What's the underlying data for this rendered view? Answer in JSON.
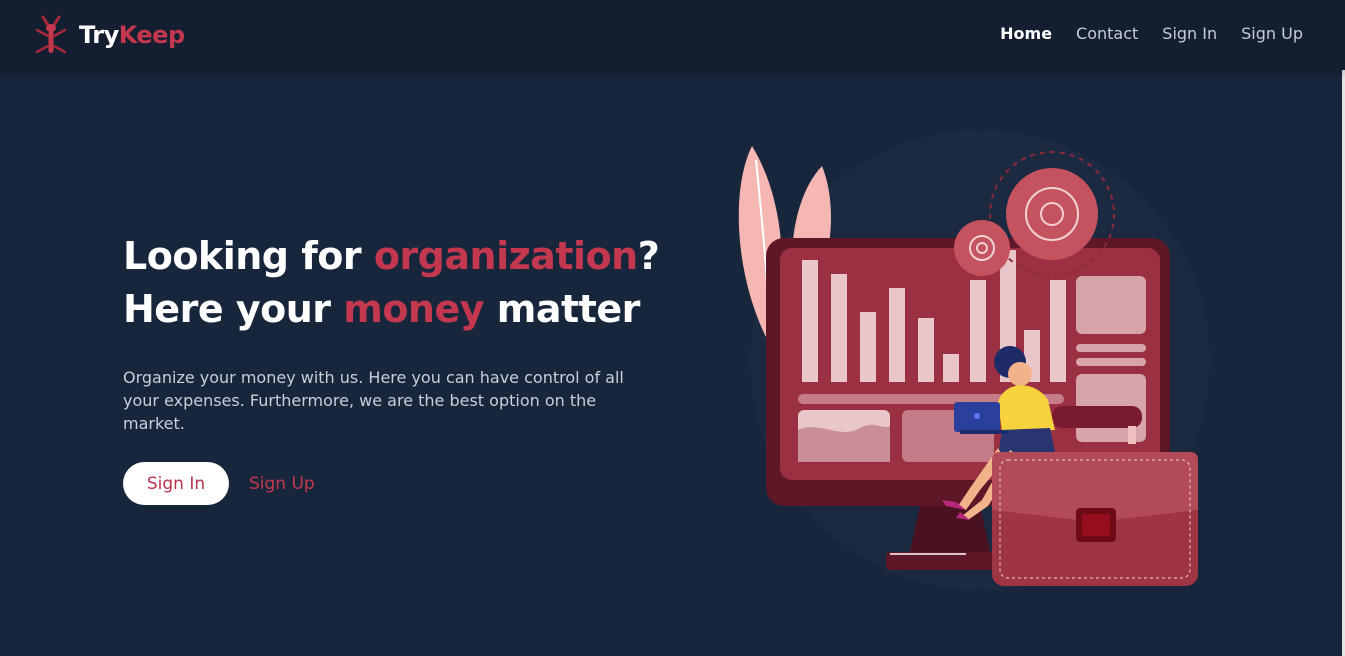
{
  "brand": {
    "name_part1": "Try",
    "name_part2": "Keep"
  },
  "nav": {
    "items": [
      {
        "label": "Home",
        "active": true
      },
      {
        "label": "Contact",
        "active": false
      },
      {
        "label": "Sign In",
        "active": false
      },
      {
        "label": "Sign Up",
        "active": false
      }
    ]
  },
  "hero": {
    "line1_pre": "Looking for ",
    "line1_accent": "organization",
    "line1_post": "?",
    "line2_pre": "Here your ",
    "line2_accent": "money",
    "line2_post": " matter",
    "description": "Organize your money with us. Here you can have control of all your expenses. Furthermore, we are the best option on the market.",
    "signin_label": "Sign In",
    "signup_label": "Sign Up"
  },
  "colors": {
    "background": "#18263b",
    "navbar": "#131f30",
    "accent": "#c4384f",
    "text": "#ffffff"
  },
  "icons": {
    "logo": "ant-logo-icon",
    "illustration": "finance-dashboard-illustration"
  }
}
